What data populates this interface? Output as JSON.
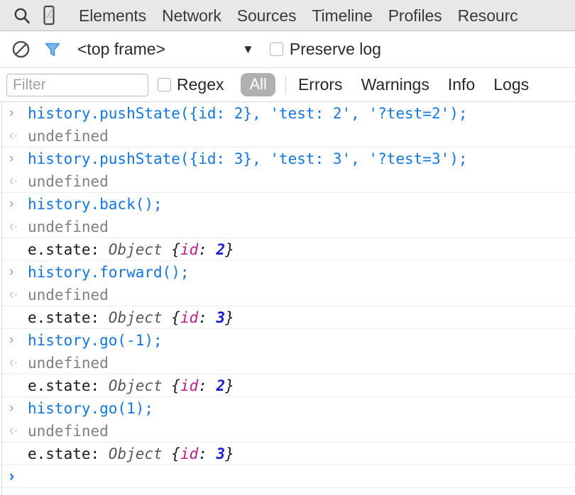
{
  "tabbar": {
    "icons": [
      {
        "name": "search-icon",
        "label": "Search"
      },
      {
        "name": "device-toolbar-icon",
        "label": "Toggle device toolbar"
      }
    ],
    "tabs": [
      {
        "label": "Elements"
      },
      {
        "label": "Network"
      },
      {
        "label": "Sources"
      },
      {
        "label": "Timeline"
      },
      {
        "label": "Profiles"
      },
      {
        "label": "Resourc"
      }
    ]
  },
  "framebar": {
    "clear_icon": "clear-console-icon",
    "filter_icon": "funnel-filter-icon",
    "frame_selector_value": "<top frame>",
    "frame_caret": "▼",
    "preserve_log_label": "Preserve log",
    "preserve_log_checked": false
  },
  "levelbar": {
    "filter_value": "",
    "filter_placeholder": "Filter",
    "regex_label": "Regex",
    "regex_checked": false,
    "levels": [
      {
        "label": "All",
        "selected": true
      },
      {
        "label": "Errors",
        "selected": false
      },
      {
        "label": "Warnings",
        "selected": false
      },
      {
        "label": "Info",
        "selected": false
      },
      {
        "label": "Logs",
        "selected": false
      }
    ]
  },
  "console": {
    "input_marker": "›",
    "output_marker": "‹·",
    "prompt_marker": "›",
    "rows": [
      {
        "kind": "input",
        "text": "history.pushState({id: 2}, 'test: 2', '?test=2');"
      },
      {
        "kind": "output",
        "text": "undefined"
      },
      {
        "kind": "input",
        "text": "history.pushState({id: 3}, 'test: 3', '?test=3');"
      },
      {
        "kind": "output",
        "text": "undefined"
      },
      {
        "kind": "input",
        "text": "history.back();"
      },
      {
        "kind": "output",
        "text": "undefined"
      },
      {
        "kind": "event",
        "prefix": "e.state: ",
        "obj": "Object",
        "open": " {",
        "key": "id",
        "sep": ": ",
        "value": "2",
        "close": "}"
      },
      {
        "kind": "input",
        "text": "history.forward();"
      },
      {
        "kind": "output",
        "text": "undefined"
      },
      {
        "kind": "event",
        "prefix": "e.state: ",
        "obj": "Object",
        "open": " {",
        "key": "id",
        "sep": ": ",
        "value": "3",
        "close": "}"
      },
      {
        "kind": "input",
        "text": "history.go(-1);"
      },
      {
        "kind": "output",
        "text": "undefined"
      },
      {
        "kind": "event",
        "prefix": "e.state: ",
        "obj": "Object",
        "open": " {",
        "key": "id",
        "sep": ": ",
        "value": "2",
        "close": "}"
      },
      {
        "kind": "input",
        "text": "history.go(1);"
      },
      {
        "kind": "output",
        "text": "undefined"
      },
      {
        "kind": "event",
        "prefix": "e.state: ",
        "obj": "Object",
        "open": " {",
        "key": "id",
        "sep": ": ",
        "value": "3",
        "close": "}"
      },
      {
        "kind": "prompt",
        "text": ""
      }
    ]
  },
  "colors": {
    "input_code": "#1077e8",
    "output_text": "#808080",
    "object_key": "#c21a8c",
    "object_number": "#1a1ae0",
    "tabbar_bg": "#e8e8e8",
    "pill_bg": "#b0b0b0",
    "funnel_blue": "#62a8f0"
  }
}
